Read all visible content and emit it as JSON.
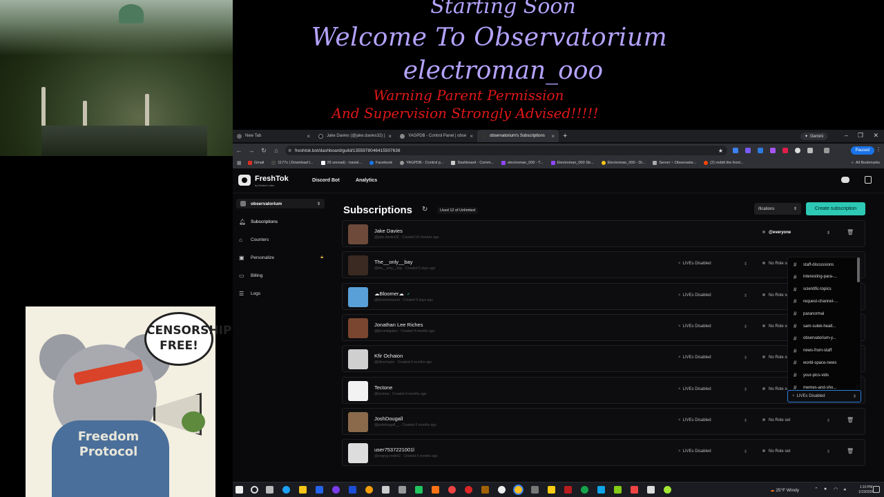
{
  "banner": {
    "line1": "Starting Soon",
    "line2": "Welcome To Observatorium",
    "line3": "electroman_ooo",
    "warning1": "Warning Parent Permission",
    "warning2": "And Supervision Strongly Advised!!!!!"
  },
  "sticker": {
    "bubble_line1": "CENSORSHIP",
    "bubble_line2": "FREE!",
    "shirt_line1": "Freedom",
    "shirt_line2": "Protocol"
  },
  "browser": {
    "tabs": [
      {
        "title": "New Tab",
        "icon": "globe-icon"
      },
      {
        "title": "Jake Davies (@jake.davies32) |",
        "icon": "tiktok-icon"
      },
      {
        "title": "YAGPDB - Control Panel | obse",
        "icon": "bot-icon"
      },
      {
        "title": "observatorium's Subscriptions",
        "icon": "freshtok-icon",
        "active": true
      }
    ],
    "gemini_label": "Gemini",
    "url": "freshtok.bot/dashboard/guild/1355978046415507638",
    "profile_label": "Paused",
    "bookmarks": [
      {
        "label": "Gmail",
        "color": "#d93025"
      },
      {
        "label": "1177x | Download t...",
        "color": "#444444"
      },
      {
        "label": "26 unread) - travisl...",
        "color": "#ffffff"
      },
      {
        "label": "Facebook",
        "color": "#1877f2"
      },
      {
        "label": "YAGPDB - Control p...",
        "color": "#999999"
      },
      {
        "label": "Dashboard - Comm...",
        "color": "#cccccc"
      },
      {
        "label": "electroman_000 - T...",
        "color": "#9147ff"
      },
      {
        "label": "Electroman_000 Str...",
        "color": "#9147ff"
      },
      {
        "label": "Electroman_000 - Di...",
        "color": "#f5c518"
      },
      {
        "label": "Server ~ Observator...",
        "color": "#aaaaaa"
      },
      {
        "label": "(2) reddit the front...",
        "color": "#ff4500"
      }
    ],
    "all_bookmarks_label": "All Bookmarks"
  },
  "app": {
    "brand": "FreshTok",
    "brand_sub": "by Modeel Labs",
    "nav": [
      "Discord Bot",
      "Analytics"
    ],
    "guild": "observatorium",
    "sidebar": [
      {
        "label": "Subscriptions",
        "icon": "bell-icon",
        "active": true
      },
      {
        "label": "Counters",
        "icon": "tag-icon"
      },
      {
        "label": "Personalize",
        "icon": "image-icon",
        "locked": true
      },
      {
        "label": "Billing",
        "icon": "card-icon"
      },
      {
        "label": "Logs",
        "icon": "list-icon"
      }
    ],
    "title": "Subscriptions",
    "usage": "Used 12 of Unlimited",
    "notif_select": "ifications",
    "create_button": "Create subscription",
    "rows": [
      {
        "name": "Jake Davies",
        "meta": "@jake.davies32 · Created 14 minutes ago",
        "lives": "",
        "role": "@everyone",
        "avatar": "#6d4a3a"
      },
      {
        "name": "The__only__bay",
        "meta": "@the__only__bay · Created 5 days ago",
        "lives": "LIVEs Disabled",
        "role": "No Role set",
        "avatar": "#3a2a22"
      },
      {
        "name": "☁Bloomer☁",
        "meta": "@bloomersound · Created 9 days ago",
        "lives": "LIVEs Disabled",
        "role": "No Role set",
        "avatar": "#5aa0d8",
        "verified": true
      },
      {
        "name": "Jonathan Lee Riches",
        "meta": "@jlinvestigates · Created 4 months ago",
        "lives": "LIVEs Disabled",
        "role": "No Role set",
        "avatar": "#7a4630"
      },
      {
        "name": "Kfir Ochaion",
        "meta": "@kfirochaion · Created 4 months ago",
        "lives": "LIVEs Disabled",
        "role": "No Role set",
        "avatar": "#cfcfcf"
      },
      {
        "name": "Tectone",
        "meta": "@tectone · Created 4 months ago",
        "lives": "LIVEs Disabled",
        "role": "No Role set",
        "avatar": "#f2f2f2"
      },
      {
        "name": "JoshDougall",
        "meta": "@joshdougall__ · Created 6 months ago",
        "lives": "LIVEs Disabled",
        "role": "No Role set",
        "avatar": "#8a6a4a"
      },
      {
        "name": "user7537221001l",
        "meta": "@ongryg ondini2 · Created 6 months ago",
        "lives": "LIVEs Disabled",
        "role": "No Role set",
        "avatar": "#dddddd"
      }
    ],
    "dropdown_channels": [
      "staff-discussions",
      "interesting-para-...",
      "scientific-topics",
      "request-channel-...",
      "paranormal",
      "sam-sulek-healt...",
      "observatorium-y...",
      "news-from-staff",
      "world-space-news",
      "your-pics-vids",
      "memes-and-sho..."
    ],
    "dropdown_current": "LIVEs Disabled"
  },
  "taskbar": {
    "weather": "25°F Windy",
    "time": "1:10 PM",
    "date": "1/19/2026"
  }
}
